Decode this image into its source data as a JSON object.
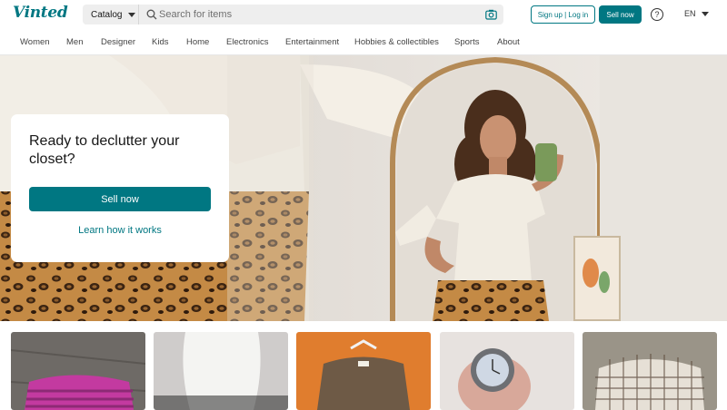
{
  "header": {
    "logo": "Vinted",
    "catalog_label": "Catalog",
    "search_placeholder": "Search for items",
    "signup_label": "Sign up | Log in",
    "sell_label": "Sell now",
    "help_icon": "question-circle-icon",
    "language": "EN"
  },
  "categories": [
    "Women",
    "Men",
    "Designer",
    "Kids",
    "Home",
    "Electronics",
    "Entertainment",
    "Hobbies & collectibles",
    "Sports",
    "About"
  ],
  "hero": {
    "title": "Ready to declutter your closet?",
    "sell_label": "Sell now",
    "learn_label": "Learn how it works"
  },
  "products": [
    {
      "name": "pink-striped-top"
    },
    {
      "name": "white-top"
    },
    {
      "name": "brown-knit-sweater"
    },
    {
      "name": "silver-watch"
    },
    {
      "name": "plaid-shirt"
    }
  ],
  "colors": {
    "brand": "#007782",
    "search_bg": "#eeeeee"
  }
}
